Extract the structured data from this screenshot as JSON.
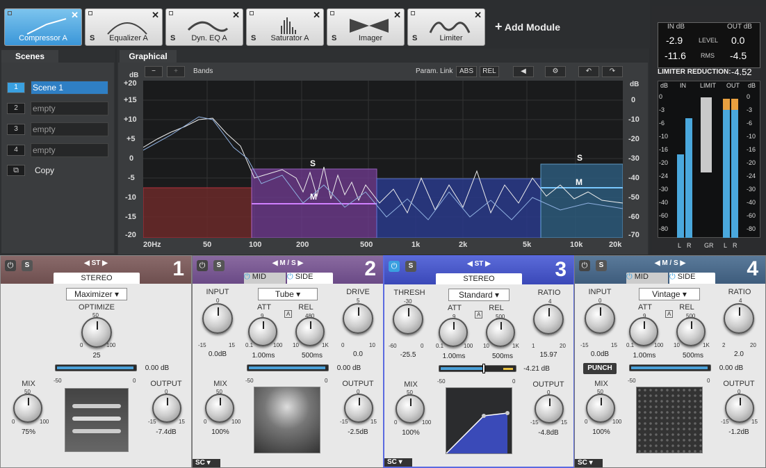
{
  "tabs": [
    {
      "name": "Compressor A",
      "active": true
    },
    {
      "name": "Equalizer A"
    },
    {
      "name": "Dyn. EQ A"
    },
    {
      "name": "Saturator A"
    },
    {
      "name": "Imager"
    },
    {
      "name": "Limiter"
    }
  ],
  "add_module": "Add Module",
  "tab_s": "S",
  "tab_x": "✕",
  "meters": {
    "in_label": "IN dB",
    "out_label": "OUT dB",
    "level_label": "LEVEL",
    "rms_label": "RMS",
    "in_level": "-2.9",
    "out_level": "0.0",
    "in_rms": "-11.6",
    "out_rms": "-4.5",
    "limiter_label": "LIMITER REDUCTION:",
    "limiter_value": "-4.52",
    "db": "dB",
    "in": "IN",
    "limit": "LIMIT",
    "out": "OUT",
    "scale": [
      "0",
      "-3",
      "-6",
      "-10",
      "-16",
      "-20",
      "-24",
      "-30",
      "-40",
      "-60",
      "-80"
    ],
    "bottom": [
      "L",
      "R",
      "GR",
      "L",
      "R"
    ]
  },
  "scenes": {
    "title": "Scenes",
    "items": [
      {
        "n": "1",
        "name": "Scene 1"
      },
      {
        "n": "2",
        "name": "empty"
      },
      {
        "n": "3",
        "name": "empty"
      },
      {
        "n": "4",
        "name": "empty"
      }
    ],
    "copy": "Copy"
  },
  "graph": {
    "title": "Graphical",
    "minus": "−",
    "plus": "+",
    "bands": "Bands",
    "param_link": "Param. Link",
    "abs": "ABS",
    "rel": "REL",
    "db_left": "dB",
    "db_right": "dB",
    "left_scale": [
      "+20",
      "+15",
      "+10",
      "+5",
      "0",
      "-5",
      "-10",
      "-15",
      "-20"
    ],
    "right_scale": [
      "0",
      "-10",
      "-20",
      "-30",
      "-40",
      "-50",
      "-60",
      "-70"
    ],
    "freq": [
      "20Hz",
      "50",
      "100",
      "200",
      "500",
      "1k",
      "2k",
      "5k",
      "10k",
      "20k"
    ],
    "s": "S",
    "m": "M"
  },
  "modules": [
    {
      "num": "1",
      "mode": "ST",
      "stereo": "STEREO",
      "dropdown": "Maximizer",
      "k1": "OPTIMIZE",
      "k1_top": "50",
      "k1_min": "0",
      "k1_max": "100",
      "k1_val": "25",
      "slider_val": "0.00 dB",
      "sl_min": "-50",
      "sl_max": "0",
      "mix": "MIX",
      "mix_top": "50",
      "mix_min": "0",
      "mix_max": "100",
      "mix_val": "75%",
      "out": "OUTPUT",
      "out_top": "0",
      "out_min": "-15",
      "out_max": "15",
      "out_val": "-7.4dB"
    },
    {
      "num": "2",
      "mode": "M / S",
      "mid": "MID",
      "side": "SIDE",
      "dropdown": "Tube",
      "input": "INPUT",
      "in_top": "0",
      "in_min": "-15",
      "in_max": "15",
      "in_val": "0.0dB",
      "att": "ATT",
      "att_top": "9",
      "att_min": "0.1",
      "att_max": "100",
      "att_val": "1.00ms",
      "rel": "REL",
      "rel_top": "480",
      "rel_min": "10",
      "rel_max": "1K",
      "rel_val": "500ms",
      "drive": "DRIVE",
      "dr_top": "5",
      "dr_min": "0",
      "dr_max": "10",
      "dr_val": "0.0",
      "a": "A",
      "slider_val": "0.00 dB",
      "sl_min": "-50",
      "sl_max": "0",
      "mix": "MIX",
      "mix_top": "50",
      "mix_min": "0",
      "mix_max": "100",
      "mix_val": "100%",
      "out": "OUTPUT",
      "out_top": "0",
      "out_min": "-15",
      "out_max": "15",
      "out_val": "-2.5dB",
      "sc": "SC"
    },
    {
      "num": "3",
      "mode": "ST",
      "stereo": "STEREO",
      "dropdown": "Standard",
      "thresh": "THRESH",
      "th_top": "-30",
      "th_min": "-60",
      "th_max": "0",
      "th_val": "-25.5",
      "att": "ATT",
      "att_top": "9",
      "att_min": "0.1",
      "att_max": "100",
      "att_val": "1.00ms",
      "rel": "REL",
      "rel_top": "500",
      "rel_min": "10",
      "rel_max": "1K",
      "rel_val": "500ms",
      "ratio": "RATIO",
      "ra_top": "4",
      "ra_min": "1",
      "ra_max": "20",
      "ra_val": "15.97",
      "a": "A",
      "slider_val": "-4.21 dB",
      "sl_min": "-50",
      "sl_max": "0",
      "mix": "MIX",
      "mix_top": "50",
      "mix_min": "0",
      "mix_max": "100",
      "mix_val": "100%",
      "out": "OUTPUT",
      "out_top": "0",
      "out_min": "-15",
      "out_max": "15",
      "out_val": "-4.8dB",
      "sc": "SC"
    },
    {
      "num": "4",
      "mode": "M / S",
      "mid": "MID",
      "side": "SIDE",
      "dropdown": "Vintage",
      "input": "INPUT",
      "in_top": "0",
      "in_min": "-15",
      "in_max": "15",
      "in_val": "0.0dB",
      "att": "ATT",
      "att_top": "9",
      "att_min": "0.1",
      "att_max": "100",
      "att_val": "1.00ms",
      "rel": "REL",
      "rel_top": "500",
      "rel_min": "10",
      "rel_max": "1K",
      "rel_val": "500ms",
      "ratio": "RATIO",
      "ra_top": "4",
      "ra_min": "2",
      "ra_max": "20",
      "ra_val": "2.0",
      "a": "A",
      "punch": "PUNCH",
      "slider_val": "0.00 dB",
      "sl_min": "-50",
      "sl_max": "0",
      "mix": "MIX",
      "mix_top": "50",
      "mix_min": "0",
      "mix_max": "100",
      "mix_val": "100%",
      "out": "OUTPUT",
      "out_top": "0",
      "out_min": "-15",
      "out_max": "15",
      "out_val": "-1.2dB",
      "sc": "SC"
    }
  ]
}
